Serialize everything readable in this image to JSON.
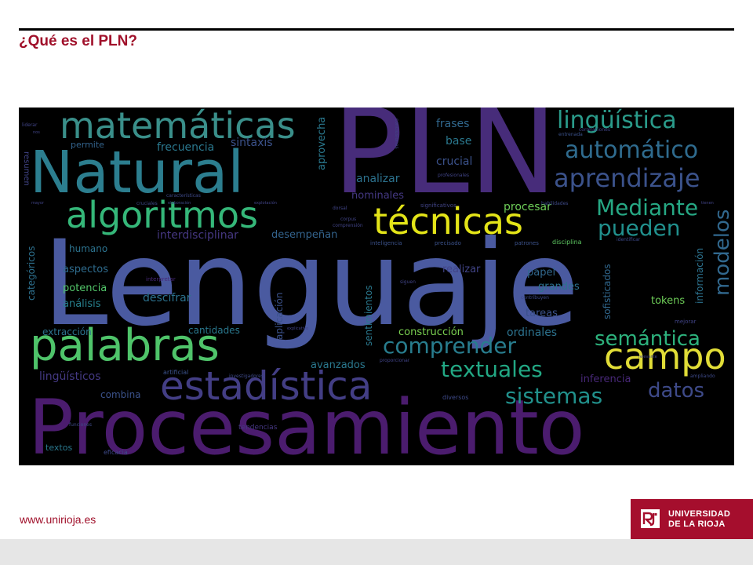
{
  "slide": {
    "title": "¿Qué es el PLN?"
  },
  "cloud": {
    "words": [
      {
        "id": "procesamiento",
        "text": "Procesamiento",
        "color": "#4b1c6e"
      },
      {
        "id": "lenguaje",
        "text": "Lenguaje",
        "color": "#4a5aa0"
      },
      {
        "id": "pln",
        "text": "PLN",
        "color": "#472c7a"
      },
      {
        "id": "natural",
        "text": "Natural",
        "color": "#2c7e8f"
      },
      {
        "id": "matematicas",
        "text": "matemáticas",
        "color": "#3a8f8a"
      },
      {
        "id": "algoritmos",
        "text": "algoritmos",
        "color": "#35b779"
      },
      {
        "id": "palabras",
        "text": "palabras",
        "color": "#4fc46a"
      },
      {
        "id": "estadistica",
        "text": "estadística",
        "color": "#433e85"
      },
      {
        "id": "tecnicas",
        "text": "técnicas",
        "color": "#e3e418"
      },
      {
        "id": "campo",
        "text": "campo",
        "color": "#e1dd37"
      },
      {
        "id": "linguistica",
        "text": "lingüística",
        "color": "#2a9b8a"
      },
      {
        "id": "automatico",
        "text": "automático",
        "color": "#2f6b8e"
      },
      {
        "id": "aprendizaje",
        "text": "aprendizaje",
        "color": "#3b528b"
      },
      {
        "id": "mediante",
        "text": "Mediante",
        "color": "#26a884"
      },
      {
        "id": "pueden",
        "text": "pueden",
        "color": "#21908d"
      },
      {
        "id": "modelos",
        "text": "modelos",
        "color": "#31688e"
      },
      {
        "id": "semantica",
        "text": "semántica",
        "color": "#2db27d"
      },
      {
        "id": "comprender",
        "text": "comprender",
        "color": "#287d8e"
      },
      {
        "id": "textuales",
        "text": "textuales",
        "color": "#22a884"
      },
      {
        "id": "sistemas",
        "text": "sistemas",
        "color": "#21918c"
      },
      {
        "id": "datos",
        "text": "datos",
        "color": "#3e4a89"
      },
      {
        "id": "procesar",
        "text": "procesar",
        "color": "#6ece58"
      },
      {
        "id": "frases",
        "text": "frases",
        "color": "#31688e"
      },
      {
        "id": "base",
        "text": "base",
        "color": "#2a788e"
      },
      {
        "id": "crucial",
        "text": "crucial",
        "color": "#3b528b"
      },
      {
        "id": "analizar",
        "text": "analizar",
        "color": "#2c728e"
      },
      {
        "id": "nominales",
        "text": "nominales",
        "color": "#443983"
      },
      {
        "id": "frecuencia",
        "text": "frecuencia",
        "color": "#2a788e"
      },
      {
        "id": "sintaxis",
        "text": "sintaxis",
        "color": "#3b528b"
      },
      {
        "id": "permite",
        "text": "permite",
        "color": "#33638d"
      },
      {
        "id": "aprovecha",
        "text": "aprovecha",
        "color": "#2a788e"
      },
      {
        "id": "interdisciplinar",
        "text": "interdisciplinar",
        "color": "#453781"
      },
      {
        "id": "desempenan",
        "text": "desempeñan",
        "color": "#33638d"
      },
      {
        "id": "humano",
        "text": "humano",
        "color": "#2c728e"
      },
      {
        "id": "aspectos",
        "text": "aspectos",
        "color": "#2f6c8e"
      },
      {
        "id": "potencia",
        "text": "potencia",
        "color": "#52c569"
      },
      {
        "id": "analisis",
        "text": "análisis",
        "color": "#27808e"
      },
      {
        "id": "descifrar",
        "text": "descifrar",
        "color": "#2c728e"
      },
      {
        "id": "categoricos",
        "text": "categóricos",
        "color": "#2d708e"
      },
      {
        "id": "extraccion",
        "text": "extracción",
        "color": "#2c728e"
      },
      {
        "id": "linguisticos",
        "text": "lingüísticos",
        "color": "#443983"
      },
      {
        "id": "cantidades",
        "text": "cantidades",
        "color": "#2a788e"
      },
      {
        "id": "construccion",
        "text": "construcción",
        "color": "#7ad151"
      },
      {
        "id": "ordinales",
        "text": "ordinales",
        "color": "#2c728e"
      },
      {
        "id": "avanzados",
        "text": "avanzados",
        "color": "#2a788e"
      },
      {
        "id": "combina",
        "text": "combina",
        "color": "#3b528b"
      },
      {
        "id": "textos",
        "text": "textos",
        "color": "#2a788e"
      },
      {
        "id": "papel",
        "text": "papel",
        "color": "#31688e"
      },
      {
        "id": "grandes",
        "text": "grandes",
        "color": "#2c728e"
      },
      {
        "id": "realizar",
        "text": "realizar",
        "color": "#414487"
      },
      {
        "id": "tareas",
        "text": "tareas",
        "color": "#3b528b"
      },
      {
        "id": "tokens",
        "text": "tokens",
        "color": "#6ece58"
      },
      {
        "id": "informacion",
        "text": "información",
        "color": "#2c728e"
      },
      {
        "id": "sofisticados",
        "text": "sofisticados",
        "color": "#31688e"
      },
      {
        "id": "aplicacion",
        "text": "aplicación",
        "color": "#3b528b"
      },
      {
        "id": "sentimientos",
        "text": "sentimientos",
        "color": "#2a788e"
      },
      {
        "id": "inferencia",
        "text": "inferencia",
        "color": "#482878"
      },
      {
        "id": "resumen",
        "text": "resumen",
        "color": "#414487"
      },
      {
        "id": "diversos",
        "text": "diversos",
        "color": "#3e4a89"
      },
      {
        "id": "tendencias",
        "text": "tendencias",
        "color": "#453781"
      },
      {
        "id": "eficacia",
        "text": "eficacia",
        "color": "#3e4a89"
      },
      {
        "id": "interpretar",
        "text": "interpretar",
        "color": "#482878"
      },
      {
        "id": "inteligencia",
        "text": "inteligencia",
        "color": "#3b528b"
      },
      {
        "id": "precisado",
        "text": "precisado",
        "color": "#3b528b"
      },
      {
        "id": "patrones",
        "text": "patrones",
        "color": "#3b528b"
      },
      {
        "id": "disciplina",
        "text": "disciplina",
        "color": "#5ec962"
      },
      {
        "id": "mejorar",
        "text": "mejorar",
        "color": "#414487"
      },
      {
        "id": "significativos",
        "text": "significativos",
        "color": "#414487"
      },
      {
        "id": "profesionales",
        "text": "profesionales",
        "color": "#414487"
      },
      {
        "id": "conclusiones",
        "text": "conclusiones",
        "color": "#414487"
      },
      {
        "id": "correlaciones",
        "text": "correlaciones",
        "color": "#414487"
      },
      {
        "id": "entrenada",
        "text": "entrenada",
        "color": "#3b528b"
      },
      {
        "id": "artificial",
        "text": "artificial",
        "color": "#3b528b"
      },
      {
        "id": "investigadores",
        "text": "investigadores",
        "color": "#3e4a89"
      },
      {
        "id": "identificar",
        "text": "identificar",
        "color": "#3e4a89"
      },
      {
        "id": "ampliando",
        "text": "ampliando",
        "color": "#3e4a89"
      },
      {
        "id": "proporcionar",
        "text": "proporcionar",
        "color": "#414487"
      },
      {
        "id": "habilidades",
        "text": "habilidades",
        "color": "#3e4a89"
      },
      {
        "id": "contribuyen",
        "text": "contribuyen",
        "color": "#3e4a89"
      },
      {
        "id": "funciones",
        "text": "funciones",
        "color": "#3e4a89"
      },
      {
        "id": "cruciales",
        "text": "cruciales",
        "color": "#3e4a89"
      },
      {
        "id": "caracteristicas",
        "text": "características",
        "color": "#3e4a89"
      },
      {
        "id": "liderar",
        "text": "liderar",
        "color": "#414487"
      },
      {
        "id": "dorsal",
        "text": "dorsal",
        "color": "#414487"
      },
      {
        "id": "corpus",
        "text": "corpus",
        "color": "#414487"
      },
      {
        "id": "comprension",
        "text": "comprensión",
        "color": "#414487"
      },
      {
        "id": "elaboracion",
        "text": "elaboración",
        "color": "#3e4a89"
      },
      {
        "id": "explotacion",
        "text": "explotación",
        "color": "#414487"
      },
      {
        "id": "sigue",
        "text": "siguen",
        "color": "#414487"
      },
      {
        "id": "mayor",
        "text": "mayor",
        "color": "#414487"
      },
      {
        "id": "relevante",
        "text": "relevante",
        "color": "#414487"
      },
      {
        "id": "explicativo",
        "text": "explicativo",
        "color": "#414487"
      },
      {
        "id": "tienen",
        "text": "tienen",
        "color": "#414487"
      },
      {
        "id": "nos",
        "text": "nos",
        "color": "#414487"
      }
    ]
  },
  "footer": {
    "url": "www.unirioja.es",
    "university_line1": "UNIVERSIDAD",
    "university_line2": "DE LA RIOJA",
    "logo_color": "#a50e2d",
    "accent_color": "#a0102a"
  }
}
